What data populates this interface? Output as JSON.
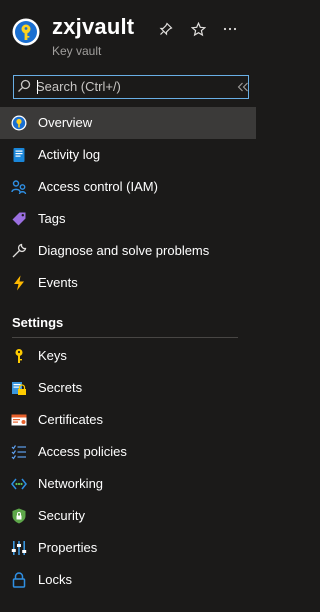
{
  "header": {
    "title": "zxjvault",
    "subtitle": "Key vault",
    "pin_icon": "pin-icon",
    "favorite_icon": "star-icon",
    "more_icon": "more-icon"
  },
  "search": {
    "placeholder": "Search (Ctrl+/)",
    "value": ""
  },
  "collapse_icon": "double-chevron-left-icon",
  "nav": {
    "items": [
      {
        "label": "Overview",
        "icon": "key-vault-icon",
        "active": true
      },
      {
        "label": "Activity log",
        "icon": "activity-log-icon"
      },
      {
        "label": "Access control (IAM)",
        "icon": "iam-icon"
      },
      {
        "label": "Tags",
        "icon": "tag-icon"
      },
      {
        "label": "Diagnose and solve problems",
        "icon": "wrench-icon"
      },
      {
        "label": "Events",
        "icon": "lightning-icon"
      }
    ]
  },
  "settings": {
    "header": "Settings",
    "items": [
      {
        "label": "Keys",
        "icon": "key-icon"
      },
      {
        "label": "Secrets",
        "icon": "secrets-icon"
      },
      {
        "label": "Certificates",
        "icon": "certificate-icon"
      },
      {
        "label": "Access policies",
        "icon": "access-policies-icon"
      },
      {
        "label": "Networking",
        "icon": "networking-icon"
      },
      {
        "label": "Security",
        "icon": "shield-icon"
      },
      {
        "label": "Properties",
        "icon": "properties-icon"
      },
      {
        "label": "Locks",
        "icon": "lock-icon"
      }
    ]
  },
  "colors": {
    "background": "#1b1a19",
    "active": "#3b3a39",
    "accent": "#69afe5",
    "muted_text": "#a19f9d"
  }
}
